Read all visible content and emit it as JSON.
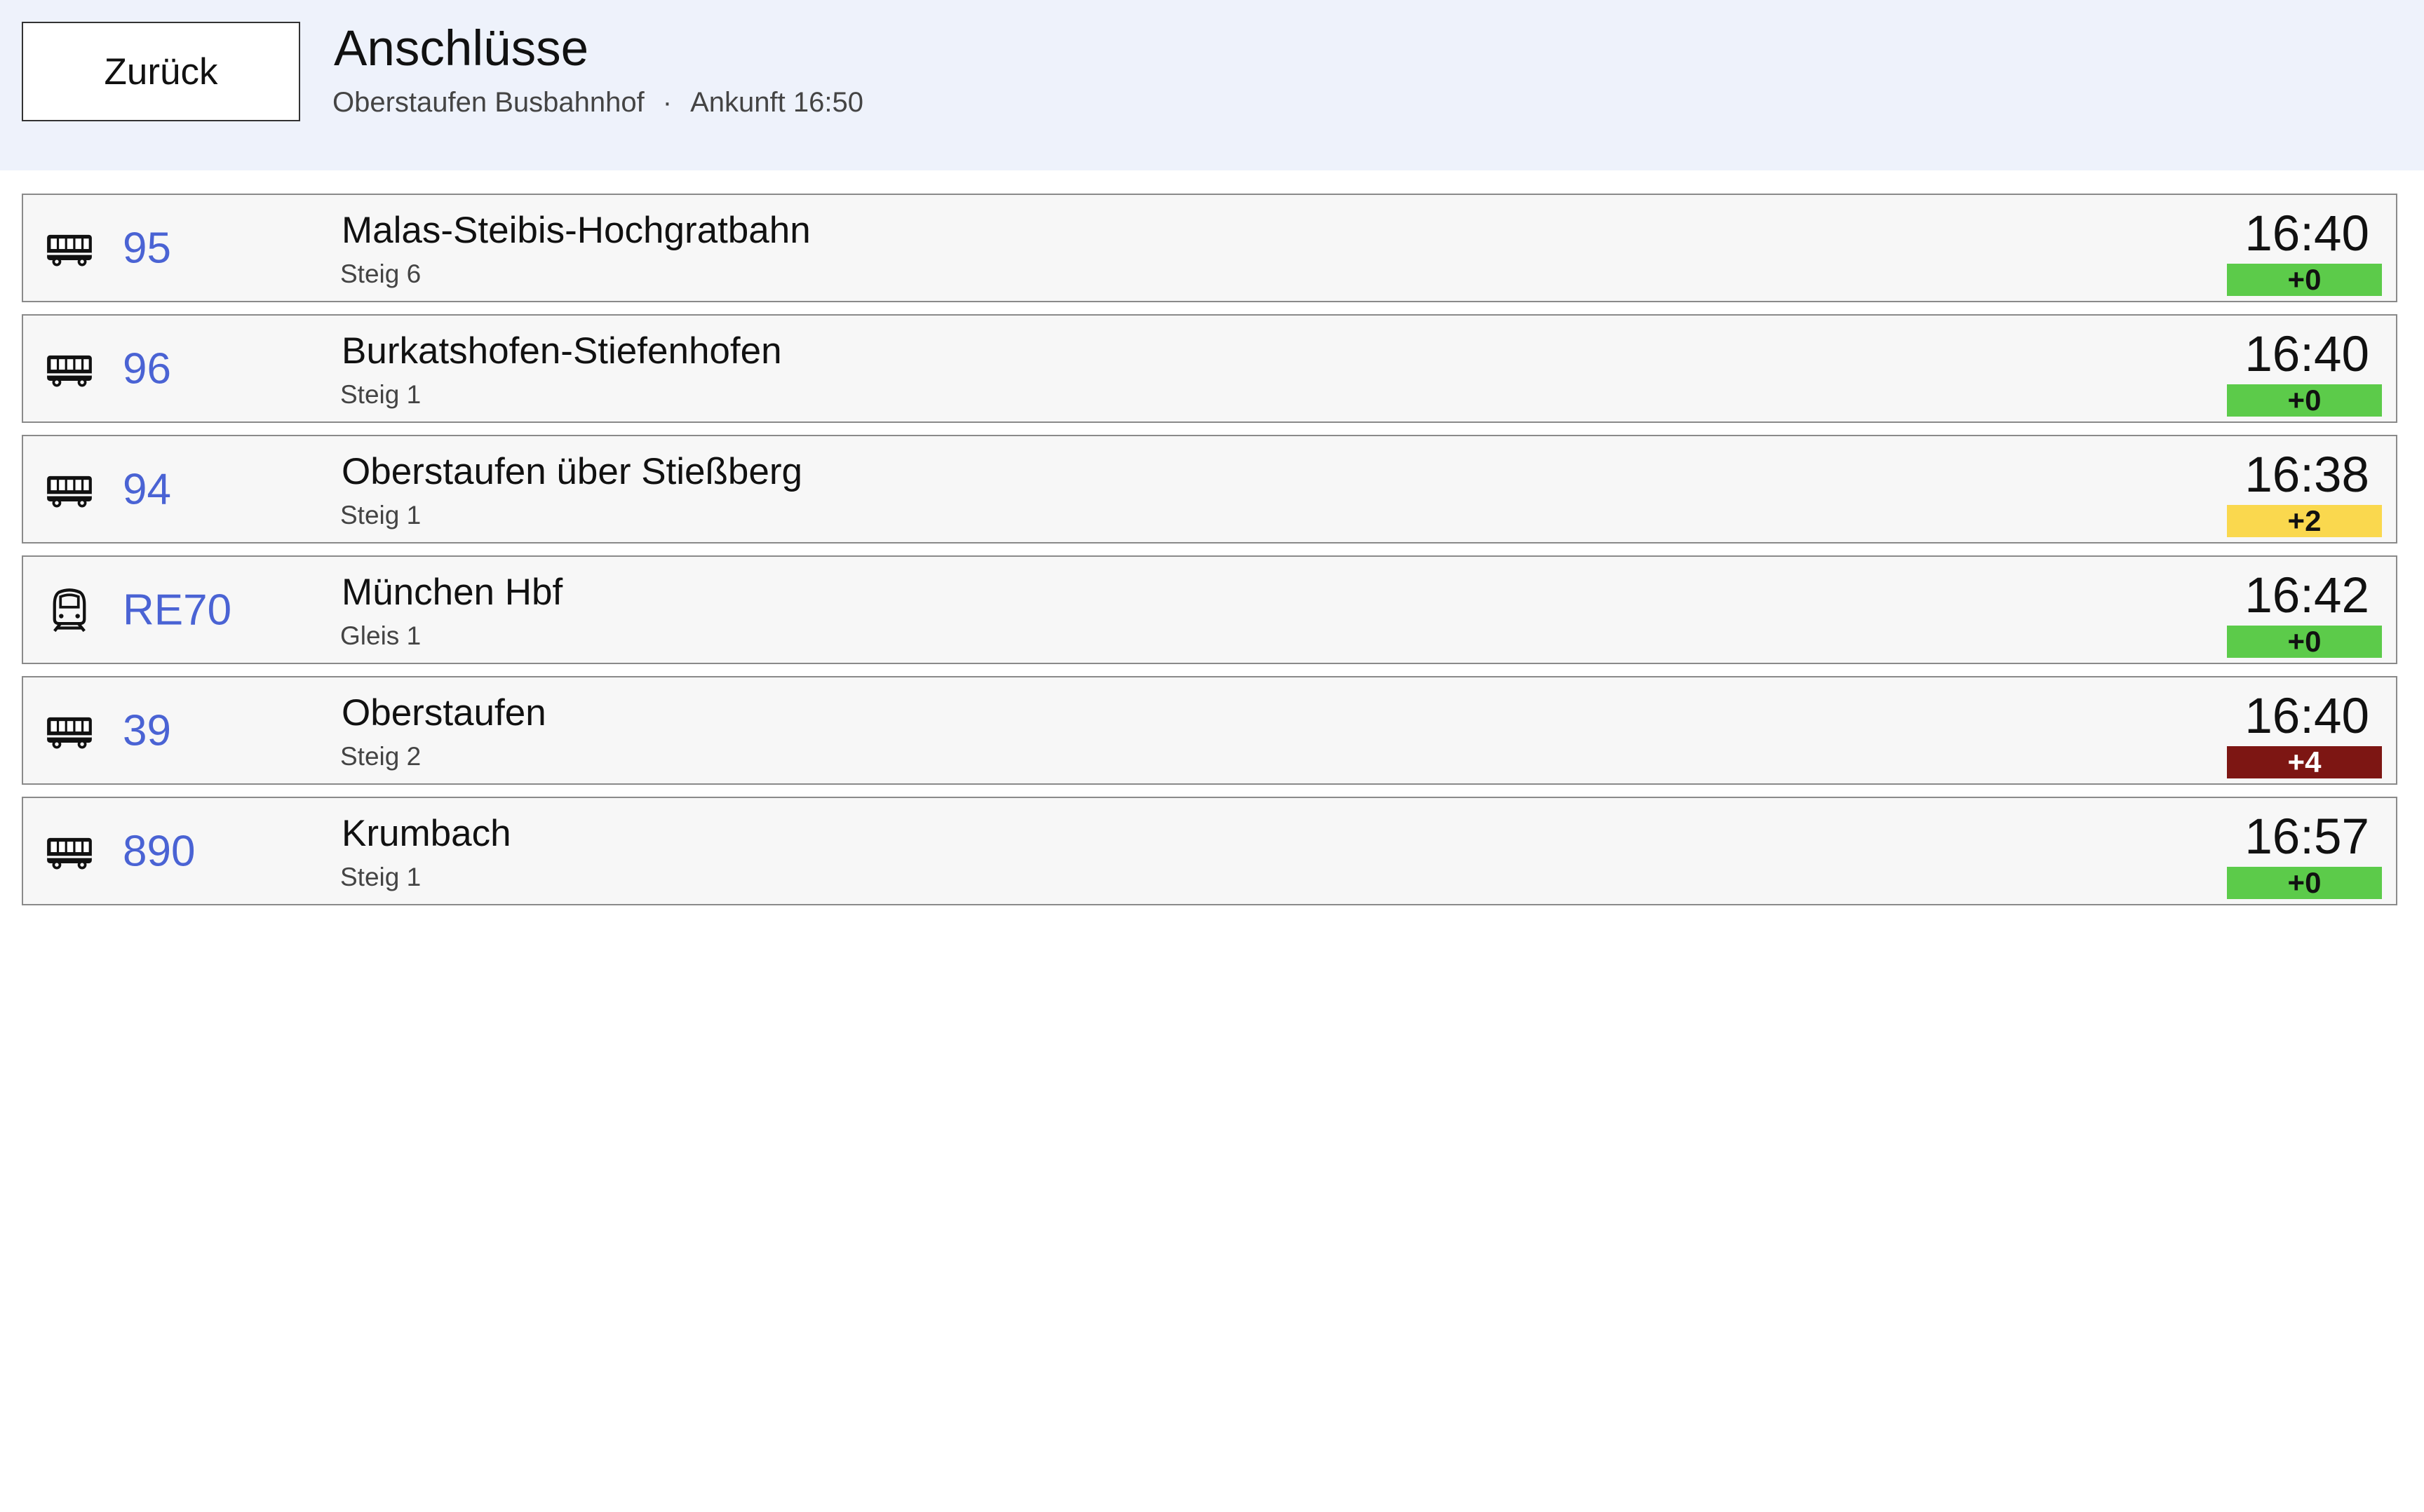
{
  "header": {
    "back_label": "Zurück",
    "title": "Anschlüsse",
    "station": "Oberstaufen Busbahnhof",
    "separator": "·",
    "arrival": "Ankunft 16:50"
  },
  "colors": {
    "header_bg": "#eef2fb",
    "line_color": "#4a63d4",
    "delay_ok": "#5ccb4a",
    "delay_warn": "#fad84e",
    "delay_late": "#7d1613"
  },
  "connections": [
    {
      "icon": "bus-icon",
      "line": "95",
      "destination": "Malas-Steibis-Hochgratbahn",
      "platform": "Steig 6",
      "time": "16:40",
      "delay": "+0",
      "delay_status": "ok"
    },
    {
      "icon": "bus-icon",
      "line": "96",
      "destination": "Burkatshofen-Stiefenhofen",
      "platform": "Steig 1",
      "time": "16:40",
      "delay": "+0",
      "delay_status": "ok"
    },
    {
      "icon": "bus-icon",
      "line": "94",
      "destination": "Oberstaufen über Stießberg",
      "platform": "Steig 1",
      "time": "16:38",
      "delay": "+2",
      "delay_status": "warn"
    },
    {
      "icon": "train-icon",
      "line": "RE70",
      "destination": "München Hbf",
      "platform": "Gleis 1",
      "time": "16:42",
      "delay": "+0",
      "delay_status": "ok"
    },
    {
      "icon": "bus-icon",
      "line": "39",
      "destination": "Oberstaufen",
      "platform": "Steig 2",
      "time": "16:40",
      "delay": "+4",
      "delay_status": "late"
    },
    {
      "icon": "bus-icon",
      "line": "890",
      "destination": "Krumbach",
      "platform": "Steig 1",
      "time": "16:57",
      "delay": "+0",
      "delay_status": "ok"
    }
  ]
}
